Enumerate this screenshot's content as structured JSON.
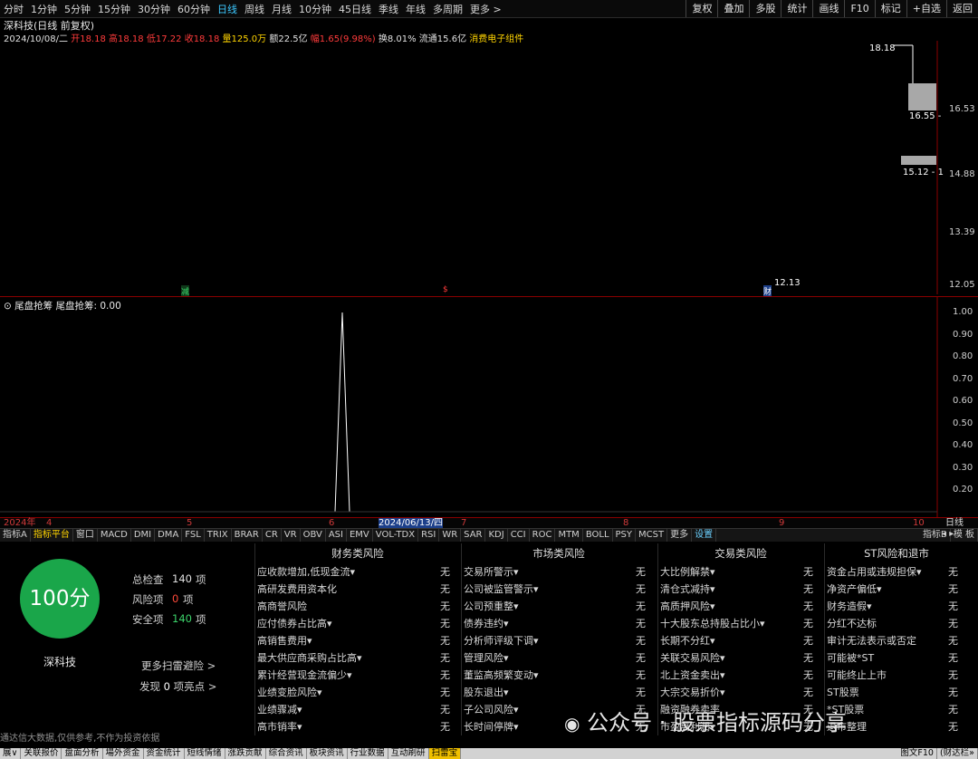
{
  "toolbar": {
    "periods": [
      "分时",
      "1分钟",
      "5分钟",
      "15分钟",
      "30分钟",
      "60分钟",
      "日线",
      "周线",
      "月线",
      "10分钟",
      "45日线",
      "季线",
      "年线",
      "多周期",
      "更多 >"
    ],
    "active_period": "日线",
    "tools": [
      "复权",
      "叠加",
      "多股",
      "统计",
      "画线",
      "F10",
      "标记",
      "+自选",
      "返回"
    ]
  },
  "main_chart": {
    "title": "深科技(日线 前复权)",
    "quote": {
      "date": "2024/10/08/二",
      "open_label": "开",
      "open": "18.18",
      "high_label": "高",
      "high": "18.18",
      "low_label": "低",
      "low": "17.22",
      "close_label": "收",
      "close": "18.18",
      "volume_label": "量",
      "volume": "125.0万",
      "amount_label": "额",
      "amount": "22.5亿",
      "change_label": "幅",
      "change": "1.65(9.98%)",
      "turnover_label": "换",
      "turnover": "8.01%",
      "float_label": "流通",
      "float": "15.6亿",
      "sector": "消费电子组件"
    },
    "y_ticks": [
      "16.53",
      "14.88",
      "13.39",
      "12.05"
    ],
    "annotations": {
      "high_price": "18.18",
      "mid_price": "16.55 -",
      "range_price": "15.12 - 1",
      "low_price": "12.13"
    },
    "markers": {
      "a": "减",
      "b": "$",
      "c": "财"
    }
  },
  "indicator": {
    "title": "尾盘抢筹",
    "value_label": "尾盘抢筹: 0.00",
    "y_ticks": [
      "1.00",
      "0.90",
      "0.80",
      "0.70",
      "0.60",
      "0.50",
      "0.40",
      "0.30",
      "0.20"
    ]
  },
  "axis": {
    "year_label": "2024年",
    "months": [
      "4",
      "5",
      "6",
      "7",
      "8",
      "9",
      "10"
    ],
    "cursor_date": "2024/06/13/四",
    "period_label": "日线"
  },
  "indicator_tabs": [
    "指标A",
    "指标平台",
    "窗口",
    "MACD",
    "DMI",
    "DMA",
    "FSL",
    "TRIX",
    "BRAR",
    "CR",
    "VR",
    "OBV",
    "ASI",
    "EMV",
    "VOL-TDX",
    "RSI",
    "WR",
    "SAR",
    "KDJ",
    "CCI",
    "ROC",
    "MTM",
    "BOLL",
    "PSY",
    "MCST",
    "更多",
    "设置",
    "指标B",
    "模 板"
  ],
  "scan": {
    "score": "100分",
    "stock_name": "深科技",
    "stats": [
      {
        "label": "总检查",
        "value": "140",
        "unit": "项",
        "color": "#e0e0e0"
      },
      {
        "label": "风险项",
        "value": "0",
        "unit": "项",
        "color": "#ff4a3a"
      },
      {
        "label": "安全项",
        "value": "140",
        "unit": "项",
        "color": "#3cd46a"
      }
    ],
    "more_link": "更多扫雷避险 >",
    "highlights_prefix": "发现",
    "highlights_count": "0",
    "highlights_suffix": "项亮点 >",
    "disclaimer": "通达信大数据,仅供参考,不作为投资依据",
    "categories": [
      {
        "title": "财务类风险",
        "items": [
          "应收款增加,低现金流▾",
          "高研发费用资本化",
          "高商誉风险",
          "应付债券占比高▾",
          "高销售费用▾",
          "最大供应商采购占比高▾",
          "累计经营现金流偏少▾",
          "业绩变脸风险▾",
          "业绩骤减▾",
          "高市销率▾"
        ]
      },
      {
        "title": "市场类风险",
        "items": [
          "交易所警示▾",
          "公司被监管警示▾",
          "公司预重整▾",
          "债券违约▾",
          "分析师评级下调▾",
          "管理风险▾",
          "董监高频繁变动▾",
          "股东退出▾",
          "子公司风险▾",
          "长时间停牌▾"
        ]
      },
      {
        "title": "交易类风险",
        "items": [
          "大比例解禁▾",
          "清仓式减持▾",
          "高质押风险▾",
          "十大股东总持股占比小▾",
          "长期不分红▾",
          "关联交易风险▾",
          "北上资金卖出▾",
          "大宗交易折价▾",
          "融资融券卖率",
          "市盈离利润▾"
        ]
      },
      {
        "title": "ST风险和退市",
        "items": [
          "资金占用或违规担保▾",
          "净资产偏低▾",
          "财务造假▾",
          "分红不达标",
          "审计无法表示或否定",
          "可能被*ST",
          "可能终止上市",
          "ST股票",
          "*ST股票",
          "退市整理"
        ]
      }
    ],
    "value_text": "无"
  },
  "bottom_tabs": [
    "展∨",
    "关联报价",
    "盘面分析",
    "場外资金",
    "资金统计",
    "短线情绪",
    "涨跌贡献",
    "综合资讯",
    "板块资讯",
    "行业数据",
    "互动刷研",
    "扫雷宝"
  ],
  "bottom_right": [
    "图文F10",
    "(财达栏»"
  ],
  "watermark": "公众号 · 股票指标源码分享"
}
